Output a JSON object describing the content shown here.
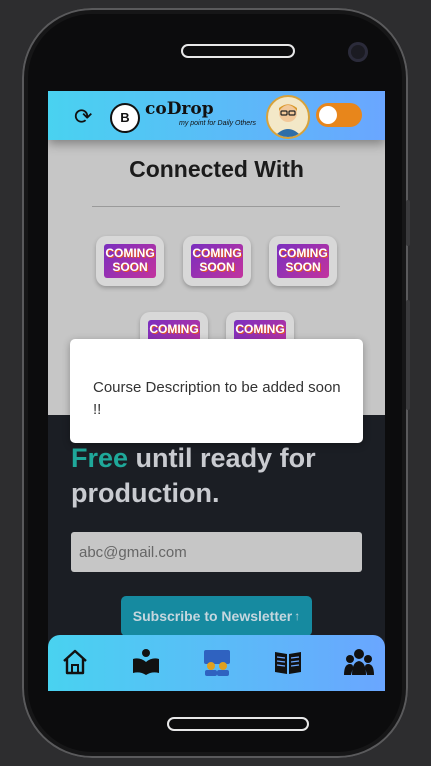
{
  "header": {
    "refresh_icon": "refresh-icon",
    "badge_letter": "B",
    "logo_text": "coDrop",
    "logo_tagline": "my point for Daily Others",
    "toggle_state": "off",
    "accent": "#e8861b"
  },
  "connected": {
    "title": "Connected With",
    "tiles": [
      {
        "line1": "COMING",
        "line2": "SOON"
      },
      {
        "line1": "COMING",
        "line2": "SOON"
      },
      {
        "line1": "COMING",
        "line2": "SOON"
      },
      {
        "line1": "COMING",
        "line2": ""
      },
      {
        "line1": "COMING",
        "line2": ""
      }
    ]
  },
  "hero": {
    "free": "Free",
    "rest": " until ready for production."
  },
  "newsletter": {
    "email_value": "abc@gmail.com",
    "button_label": "Subscribe to Newsletter",
    "arrow": "↑"
  },
  "modal": {
    "message": "Course Description to be added soon !!"
  },
  "bottom_nav": {
    "items": [
      "home-icon",
      "book-reader-icon",
      "classroom-icon",
      "newspaper-icon",
      "community-icon"
    ]
  }
}
